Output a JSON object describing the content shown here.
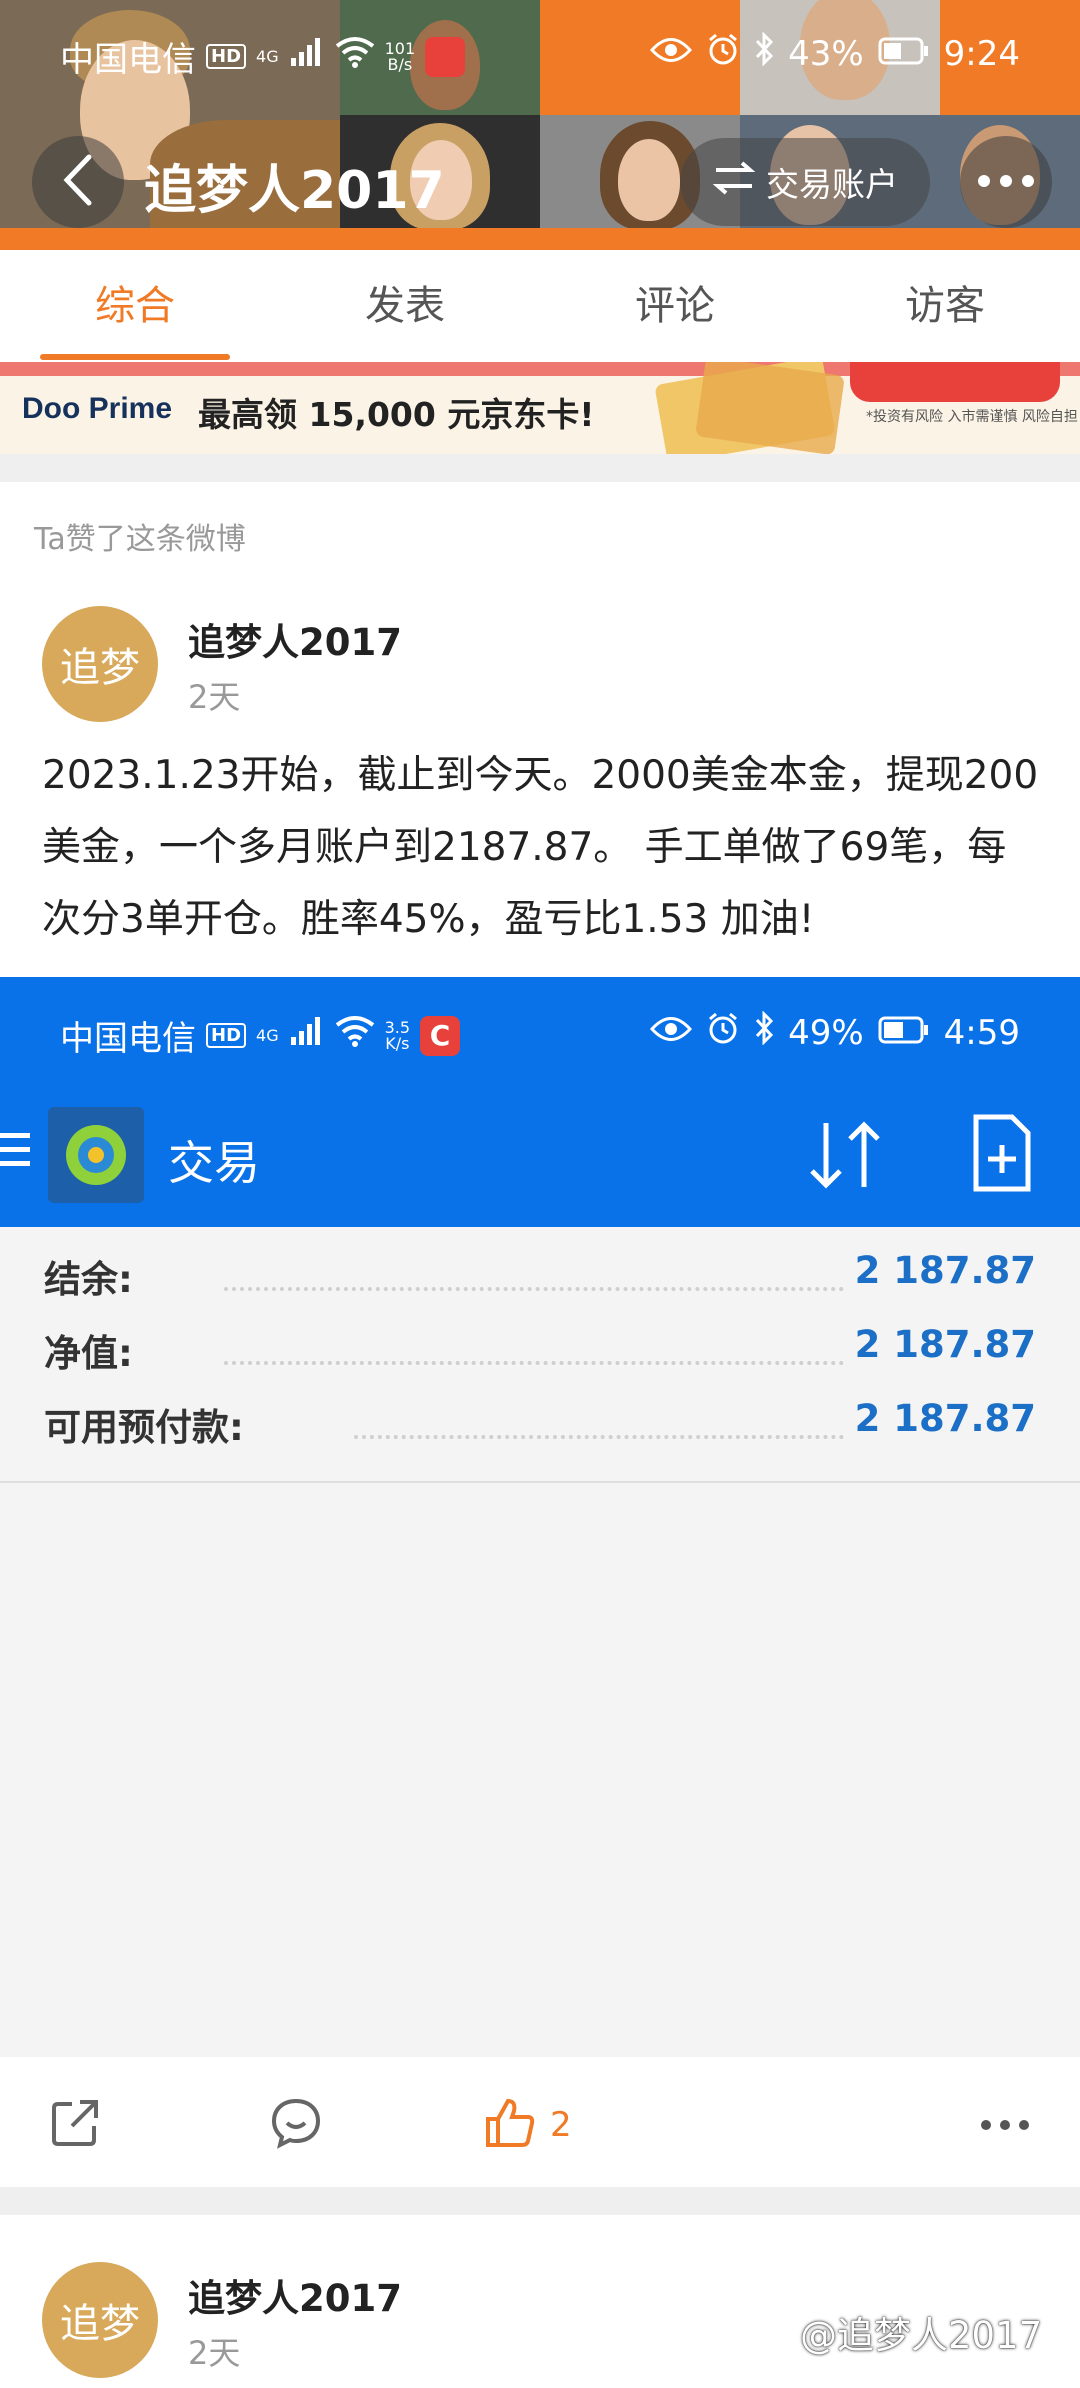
{
  "status_bar": {
    "carrier": "中国电信",
    "network_badge": "HD",
    "signal_label": "4G",
    "speed_value": "101",
    "speed_unit": "B/s",
    "battery": "43%",
    "time": "9:24"
  },
  "header": {
    "title": "追梦人2017",
    "account_button": "交易账户",
    "back_icon": "chevron-left-icon",
    "more_icon": "more-horizontal-icon"
  },
  "tabs": [
    {
      "label": "综合",
      "active": true
    },
    {
      "label": "发表",
      "active": false
    },
    {
      "label": "评论",
      "active": false
    },
    {
      "label": "访客",
      "active": false
    }
  ],
  "ad": {
    "brand": "Doo Prime",
    "promo": "最高领 15,000 元京东卡!",
    "note": "*投资有风险 入市需谨慎 风险自担"
  },
  "post": {
    "liked_label": "Ta赞了这条微博",
    "avatar_text": "追梦",
    "author": "追梦人2017",
    "time": "2天",
    "text": "2023.1.23开始，截止到今天。2000美金本金，提现200美金，一个多月账户到2187.87。 手工单做了69笔，每次分3单开仓。胜率45%，盈亏比1.53 加油!"
  },
  "embedded": {
    "status_bar": {
      "carrier": "中国电信",
      "network_badge": "HD",
      "signal_label": "4G",
      "speed_value": "3.5",
      "speed_unit": "K/s",
      "battery": "49%",
      "time": "4:59"
    },
    "app_title": "交易",
    "summary": [
      {
        "label": "结余:",
        "value": "2 187.87"
      },
      {
        "label": "净值:",
        "value": "2 187.87"
      },
      {
        "label": "可用预付款:",
        "value": "2 187.87"
      }
    ]
  },
  "actions": {
    "share_icon": "share-icon",
    "comment_icon": "comment-icon",
    "like_icon": "thumbs-up-icon",
    "like_count": "2",
    "more_icon": "more-horizontal-icon"
  },
  "next_post": {
    "avatar_text": "追梦",
    "author": "追梦人2017",
    "time": "2天"
  },
  "watermark": "@追梦人2017",
  "colors": {
    "accent_orange": "#f07a25",
    "mt4_blue": "#0a72e8",
    "value_blue": "#1b6fc6"
  }
}
